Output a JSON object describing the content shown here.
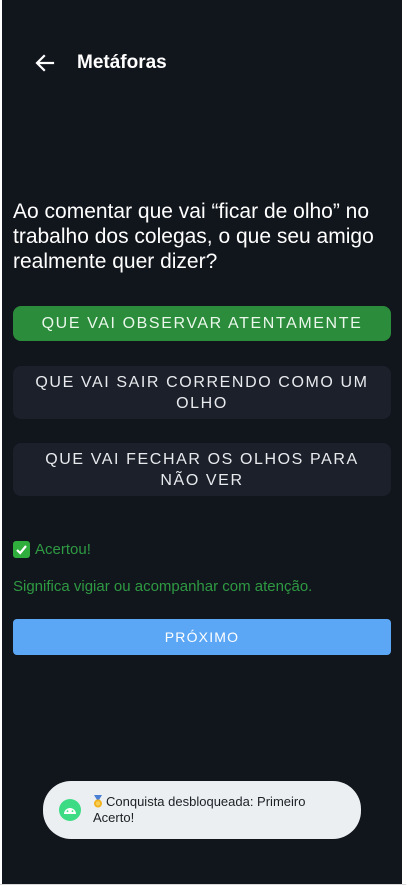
{
  "appbar": {
    "title": "Metáforas"
  },
  "question": {
    "text": "Ao comentar que vai “ficar de olho” no trabalho dos colegas, o que seu amigo realmente quer dizer?"
  },
  "options": [
    {
      "label": "QUE VAI OBSERVAR ATENTAMENTE",
      "state": "correct"
    },
    {
      "label": "QUE VAI SAIR CORRENDO COMO UM OLHO",
      "state": "neutral"
    },
    {
      "label": "QUE VAI FECHAR OS OLHOS PARA NÃO VER",
      "state": "neutral"
    }
  ],
  "feedback": {
    "result": "Acertou!",
    "explanation": "Significa vigiar ou acompanhar com atenção."
  },
  "next_button": {
    "label": "PRÓXIMO"
  },
  "toast": {
    "text": "Conquista desbloqueada: Primeiro Acerto!"
  },
  "colors": {
    "background": "#11151c",
    "correct": "#2b8c3c",
    "feedback_green": "#2e9a42",
    "primary_button": "#5ba7f5",
    "option_neutral": "#1b202a"
  },
  "icons": {
    "back": "arrow-left-icon",
    "result": "check-mark-icon",
    "toast_app": "android-icon",
    "toast_emoji": "medal-icon"
  }
}
